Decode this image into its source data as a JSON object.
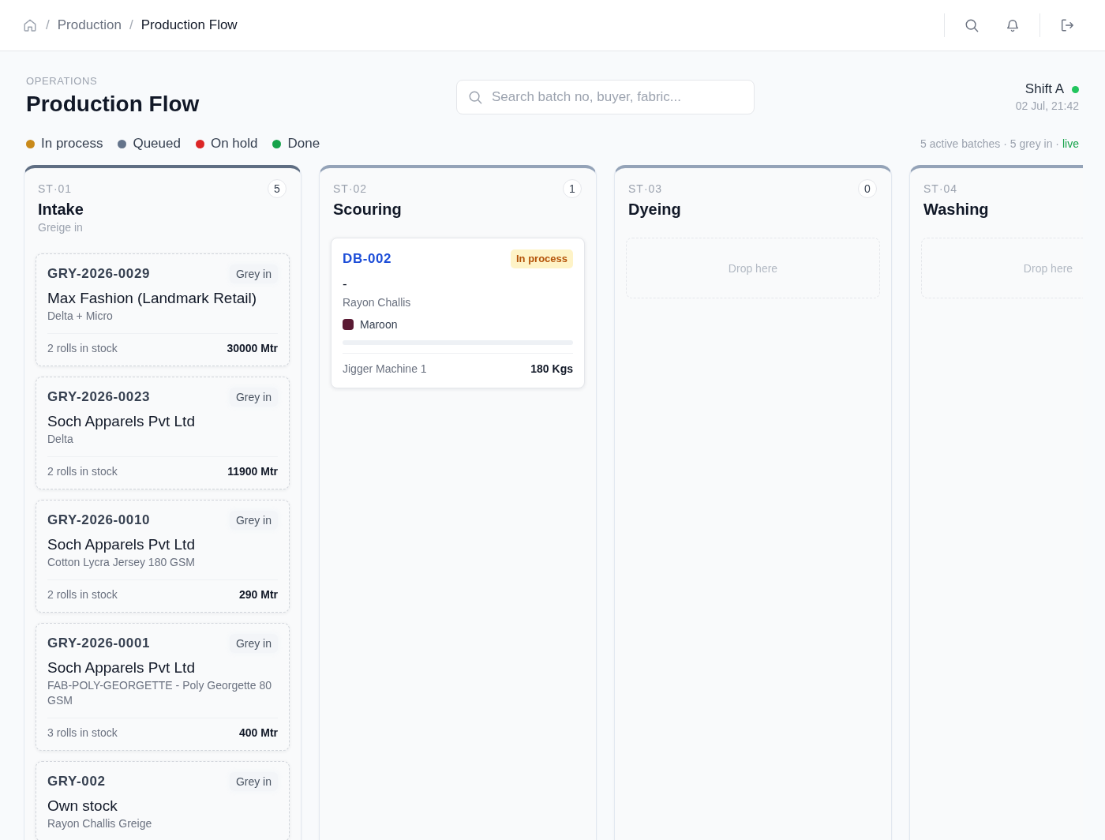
{
  "breadcrumb": [
    {
      "separator": "/",
      "label": "Production",
      "current": false
    },
    {
      "separator": "/",
      "label": "Production Flow",
      "current": true
    }
  ],
  "header": {
    "eyebrow": "OPERATIONS",
    "title": "Production Flow"
  },
  "search": {
    "placeholder": "Search batch no, buyer, fabric..."
  },
  "shift": {
    "name": "Shift A",
    "online": true,
    "datetime": "02 Jul, 21:42"
  },
  "legend": [
    {
      "label": "In process",
      "color": "#c98a1b"
    },
    {
      "label": "Queued",
      "color": "#64748b"
    },
    {
      "label": "On hold",
      "color": "#dc2626"
    },
    {
      "label": "Done",
      "color": "#16a34a"
    }
  ],
  "summary": {
    "text": "5 active batches · 5 grey in ·",
    "status": "live"
  },
  "columns": [
    {
      "code": "ST·01",
      "title": "Intake",
      "subtitle": "Greige in",
      "count": "5",
      "active": true,
      "cards": [
        {
          "kind": "grey",
          "id": "GRY-2026-0029",
          "tag": "Grey in",
          "buyer": "Max Fashion (Landmark Retail)",
          "fabric": "Delta + Micro",
          "rolls": "2 rolls in stock",
          "quantity": "30000 Mtr"
        },
        {
          "kind": "grey",
          "id": "GRY-2026-0023",
          "tag": "Grey in",
          "buyer": "Soch Apparels Pvt Ltd",
          "fabric": "Delta",
          "rolls": "2 rolls in stock",
          "quantity": "11900 Mtr"
        },
        {
          "kind": "grey",
          "id": "GRY-2026-0010",
          "tag": "Grey in",
          "buyer": "Soch Apparels Pvt Ltd",
          "fabric": "Cotton Lycra Jersey 180 GSM",
          "rolls": "2 rolls in stock",
          "quantity": "290 Mtr"
        },
        {
          "kind": "grey",
          "id": "GRY-2026-0001",
          "tag": "Grey in",
          "buyer": "Soch Apparels Pvt Ltd",
          "fabric": "FAB-POLY-GEORGETTE - Poly Georgette 80 GSM",
          "rolls": "3 rolls in stock",
          "quantity": "400 Mtr"
        },
        {
          "kind": "grey",
          "id": "GRY-002",
          "tag": "Grey in",
          "buyer": "Own stock",
          "fabric": "Rayon Challis Greige"
        }
      ]
    },
    {
      "code": "ST·02",
      "title": "Scouring",
      "count": "1",
      "active": false,
      "cards": [
        {
          "kind": "batch",
          "id": "DB-002",
          "status": "In process",
          "buyer": "-",
          "fabric": "Rayon Challis",
          "shade": "Maroon",
          "color": "#5a1a33",
          "machine": "Jigger Machine 1",
          "quantity": "180 Kgs"
        }
      ]
    },
    {
      "code": "ST·03",
      "title": "Dyeing",
      "count": "0",
      "active": false,
      "drop_hint": "Drop here"
    },
    {
      "code": "ST·04",
      "title": "Washing",
      "active": false,
      "drop_hint": "Drop here"
    }
  ]
}
